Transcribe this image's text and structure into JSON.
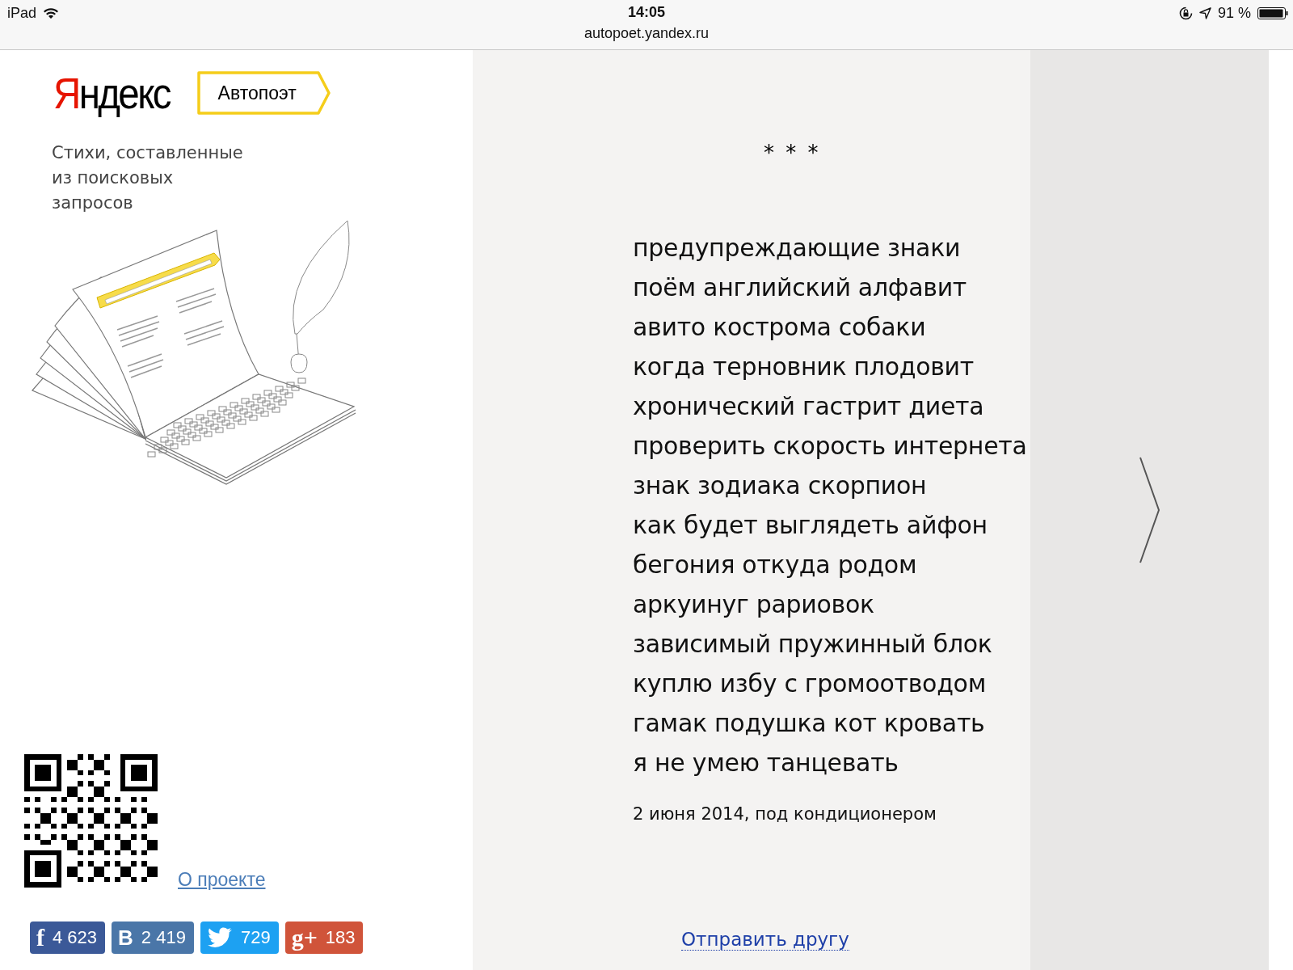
{
  "status_bar": {
    "device": "iPad",
    "time": "14:05",
    "url": "autopoet.yandex.ru",
    "battery": "91 %"
  },
  "sidebar": {
    "logo": "Яндекс",
    "badge": "Автопоэт",
    "tagline": "Стихи, составленные из поисковых запросов",
    "about_link": "О проекте",
    "share_buttons": [
      {
        "kind": "facebook",
        "glyph": "f",
        "count": "4 623",
        "color": "#3b5998"
      },
      {
        "kind": "vkontakte",
        "glyph": "В",
        "count": "2 419",
        "color": "#4a76a8"
      },
      {
        "kind": "twitter",
        "count": "729",
        "color": "#1da1f2"
      },
      {
        "kind": "googleplus",
        "glyph": "g+",
        "count": "183",
        "color": "#d0543a"
      }
    ]
  },
  "poem": {
    "title": "* * *",
    "lines": [
      "предупреждающие знаки",
      "поём английский алфавит",
      "авито кострома собаки",
      "когда терновник плодовит",
      "хронический гастрит диета",
      "проверить скорость интернета",
      "знак зодиака скорпион",
      "как будет выглядеть айфон",
      "бегония откуда родом",
      "аркуинуг рариовок",
      "зависимый пружинный блок",
      "куплю избу с громоотводом",
      "гамак подушка кот кровать",
      "я не умею танцевать"
    ],
    "caption": "2 июня 2014, под кондиционером",
    "send_link": "Отправить другу"
  }
}
